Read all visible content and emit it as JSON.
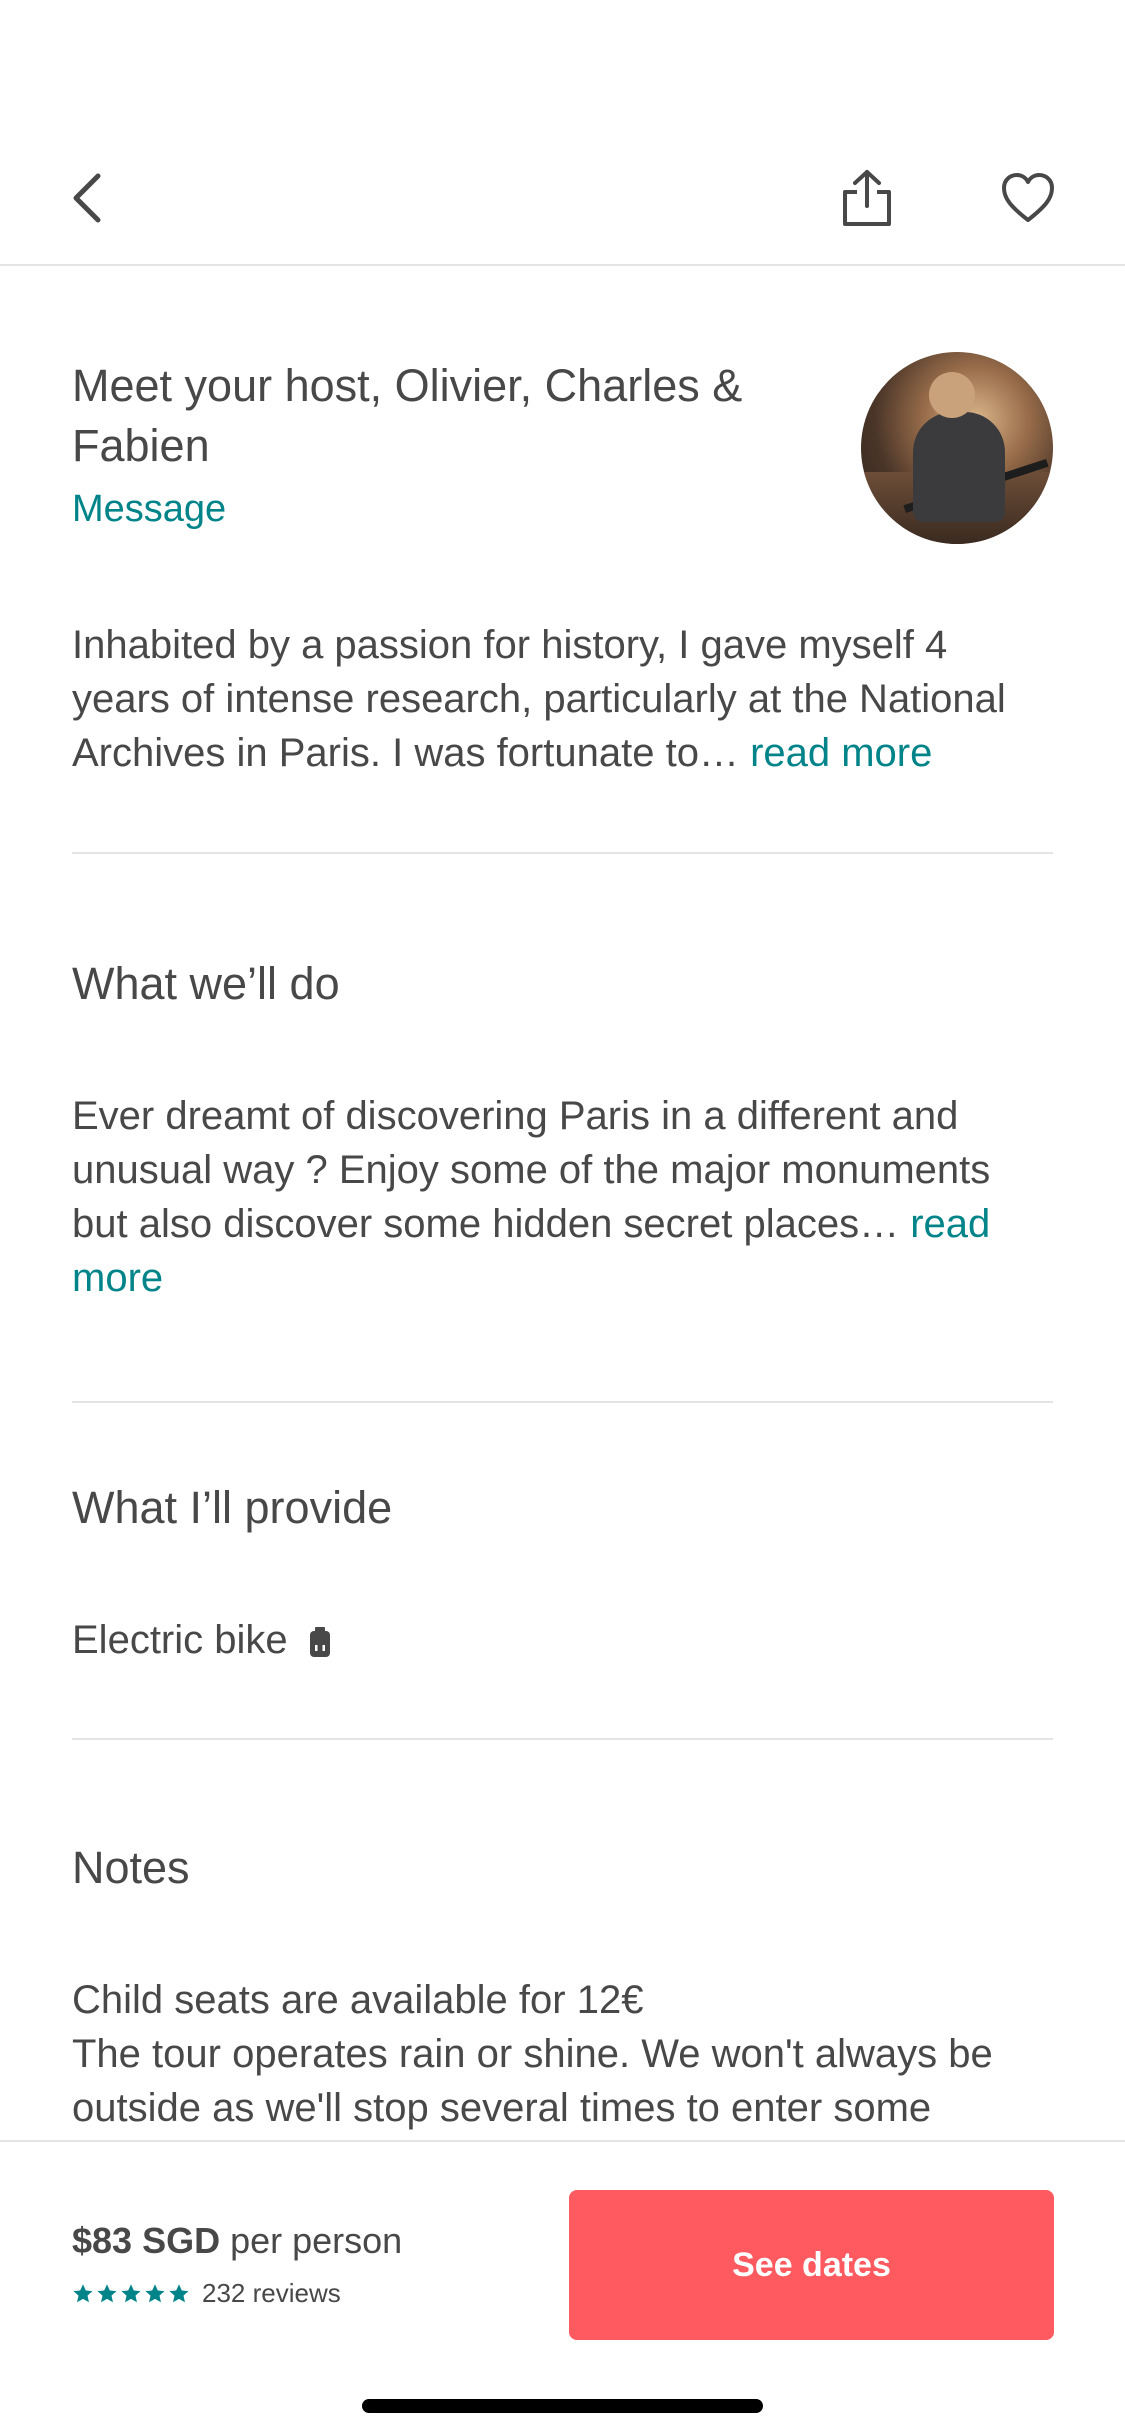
{
  "nav": {
    "back_icon": "chevron-left-icon",
    "share_icon": "share-icon",
    "save_icon": "heart-icon"
  },
  "host": {
    "title": "Meet your host, Olivier, Charles & Fabien",
    "message_label": "Message",
    "bio": "Inhabited by a passion for history, I gave myself 4 years of intense research, particularly at the National Archives in Paris. I was fortunate to…",
    "read_more": "read more"
  },
  "what_well_do": {
    "title": "What we’ll do",
    "body": "Ever dreamt of discovering Paris in a different and unusual way ? Enjoy some of the major monuments but also discover some hidden secret places…",
    "read_more": "read more"
  },
  "what_ill_provide": {
    "title": "What I’ll provide",
    "item": "Electric bike",
    "item_icon": "battery-icon"
  },
  "notes": {
    "title": "Notes",
    "line1": "Child seats are available for 12€",
    "line2": "The tour operates rain or shine. We won't always be outside as we'll stop several times to enter some"
  },
  "booking": {
    "price": "$83 SGD",
    "per": "per person",
    "rating_stars": 5,
    "reviews": "232 reviews",
    "cta_label": "See dates",
    "accent": "#FF5A5F",
    "link_color": "#008489"
  }
}
